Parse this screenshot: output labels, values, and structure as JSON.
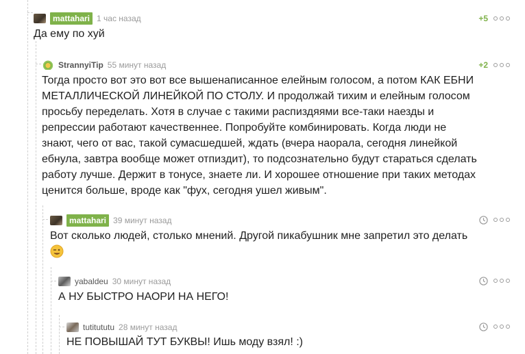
{
  "comments": [
    {
      "nick": "mattahari",
      "time": "1 час назад",
      "rating": "+5",
      "text": "Да ему по хуй"
    },
    {
      "nick": "StrannyiTip",
      "time": "55 минут назад",
      "rating": "+2",
      "lines": [
        "Тогда просто вот это вот все вышенаписанное елейным голосом, а потом КАК ЕБНИ",
        "МЕТАЛЛИЧЕСКОЙ ЛИНЕЙКОЙ ПО СТОЛУ. И продолжай тихим и елейным голосом",
        "просьбу переделать. Хотя в случае с такими распиздяями все-таки наезды и",
        "репрессии работают качественнее. Попробуйте комбинировать. Когда люди не",
        "знают, чего от вас, такой сумасшедшей, ждать (вчера наорала, сегодня линейкой",
        "ебнула, завтра вообще может отпиздит), то подсознательно будут стараться сделать",
        "работу лучше. Держит в тонусе, знаете ли. И хорошее отношение при таких методах",
        "ценится больше, вроде как \"фух, сегодня ушел живым\"."
      ]
    },
    {
      "nick": "mattahari",
      "time": "39 минут назад",
      "text": "Вот сколько людей, столько мнений. Другой пикабушник мне запретил это делать",
      "emoji": "wink-emoji"
    },
    {
      "nick": "yabaldeu",
      "time": "30 минут назад",
      "text": "А НУ БЫСТРО НАОРИ НА НЕГО!"
    },
    {
      "nick": "tutitututu",
      "time": "28 минут назад",
      "text": "НЕ ПОВЫШАЙ ТУТ БУКВЫ! Ишь моду взял! :)"
    }
  ],
  "colors": {
    "accent": "#7fb24a",
    "muted": "#9a9a9a",
    "text": "#1f1f1f"
  }
}
